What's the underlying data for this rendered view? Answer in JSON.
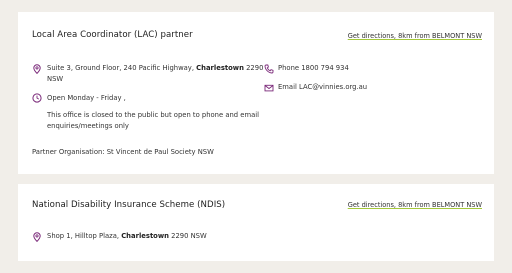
{
  "cards": [
    {
      "title": "Local Area Coordinator (LAC) partner",
      "directions": "Get directions, 8km from BELMONT NSW",
      "address_prefix": "Suite 3, Ground Floor, 240 Pacific Highway, ",
      "address_suburb": "Charlestown",
      "address_suffix": " 2290 NSW",
      "hours": "Open Monday - Friday ,",
      "note": "This office is closed to the public but open to phone and email enquiries/meetings only",
      "partner": "Partner Organisation: St Vincent de Paul Society NSW",
      "phone": "Phone 1800 794 934",
      "email": "Email LAC@vinnies.org.au"
    },
    {
      "title": "National Disability Insurance Scheme (NDIS)",
      "directions": "Get directions, 8km from BELMONT NSW",
      "address_prefix": "Shop 1, Hilltop Plaza, ",
      "address_suburb": "Charlestown",
      "address_suffix": " 2290 NSW"
    }
  ],
  "colors": {
    "background": "#f1eee9",
    "icon": "#7b2a7a",
    "underline": "#a5c93a"
  },
  "icons": {
    "address": "map-pin-icon",
    "hours": "clock-icon",
    "phone": "phone-icon",
    "email": "mail-icon"
  }
}
